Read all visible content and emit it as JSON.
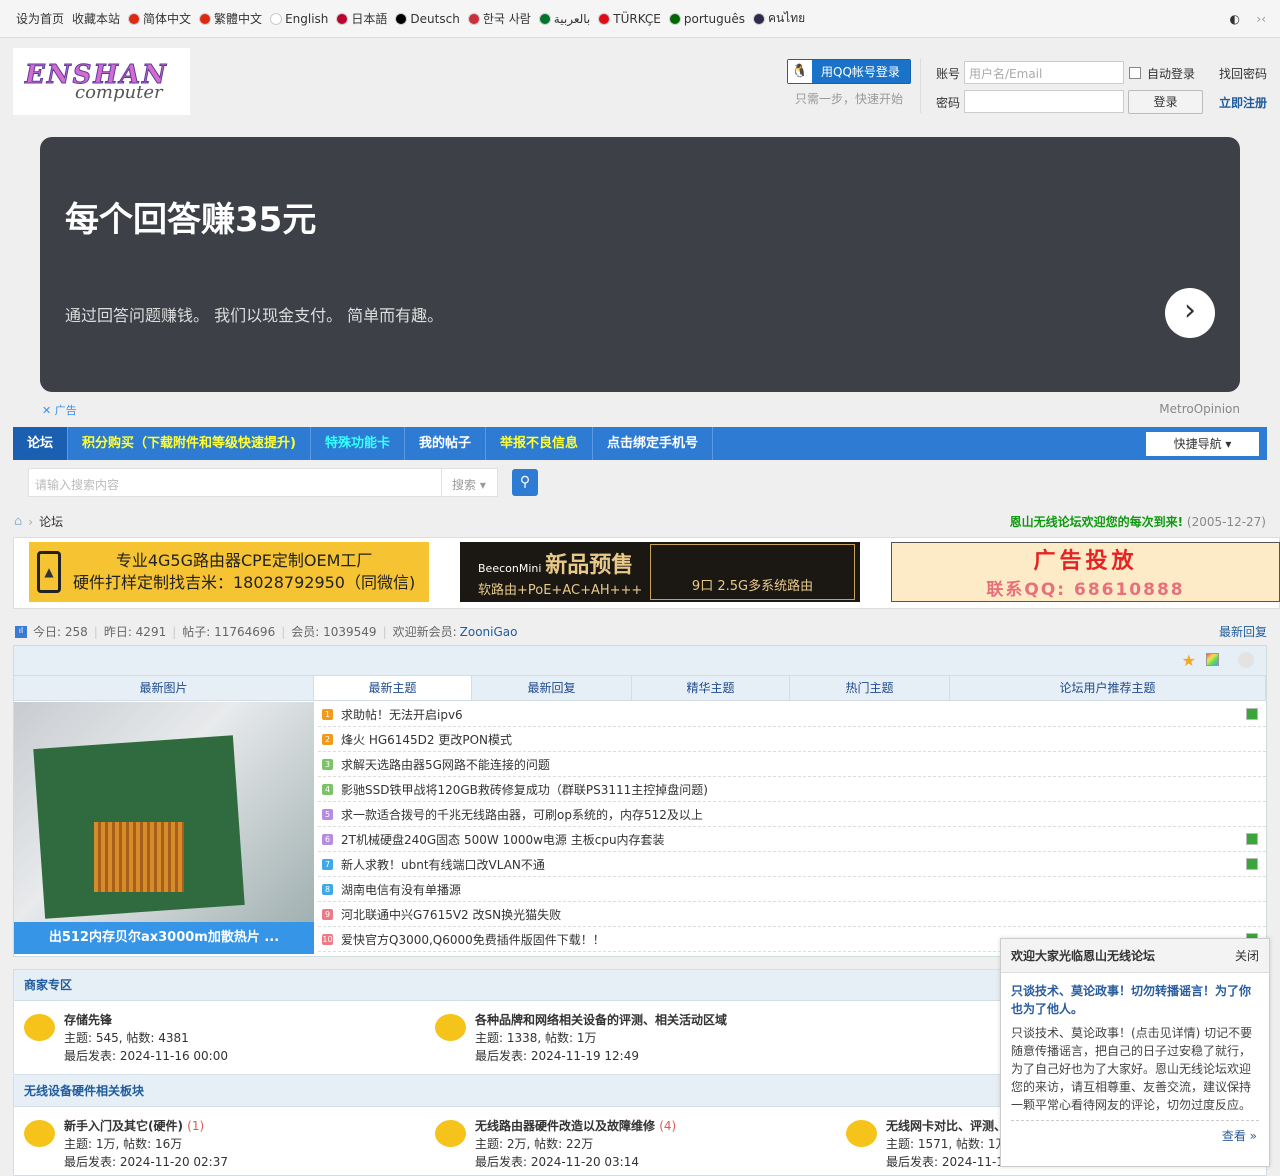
{
  "topbar": {
    "set_home": "设为首页",
    "favorite": "收藏本站",
    "langs": [
      {
        "label": "简体中文",
        "color": "#de2910"
      },
      {
        "label": "繁體中文",
        "color": "#de2910"
      },
      {
        "label": "English",
        "color": "#ffffff"
      },
      {
        "label": "日本語",
        "color": "#bc002d"
      },
      {
        "label": "Deutsch",
        "color": "#000000"
      },
      {
        "label": "한국 사람",
        "color": "#cd2e3a"
      },
      {
        "label": "بالعربية",
        "color": "#00732f"
      },
      {
        "label": "TÜRKÇE",
        "color": "#e30a17"
      },
      {
        "label": "português",
        "color": "#006600"
      },
      {
        "label": "คนไทย",
        "color": "#2d2a4a"
      }
    ]
  },
  "logo": {
    "line1": "ENSHAN",
    "line2": "computer"
  },
  "login": {
    "qq_button": "用QQ帐号登录",
    "qq_sub": "只需一步，快速开始",
    "account_label": "账号",
    "account_placeholder": "用户名/Email",
    "password_label": "密码",
    "auto_login": "自动登录",
    "find_password": "找回密码",
    "login_button": "登录",
    "register": "立即注册"
  },
  "banner": {
    "headline": "每个回答赚35元",
    "sub": "通过回答问题赚钱。 我们以现金支付。 简单而有趣。",
    "ad_tag": "广告",
    "brand": "MetroOpinion"
  },
  "nav": {
    "items": [
      {
        "label": "论坛",
        "color": "#ffffff"
      },
      {
        "label": "积分购买（下载附件和等级快速提升)",
        "color": "#ffff33"
      },
      {
        "label": "特殊功能卡",
        "color": "#33ffff"
      },
      {
        "label": "我的帖子",
        "color": "#ffffff"
      },
      {
        "label": "举报不良信息",
        "color": "#ffff33"
      },
      {
        "label": "点击绑定手机号",
        "color": "#ffffff"
      }
    ],
    "quick_nav": "快捷导航"
  },
  "search": {
    "placeholder": "请输入搜索内容",
    "type": "搜索"
  },
  "breadcrumb": {
    "current": "论坛"
  },
  "welcome": {
    "text": "恩山无线论坛欢迎您的每次到来!",
    "date": "(2005-12-27)"
  },
  "ads": [
    {
      "line1": "专业4G5G路由器CPE定制OEM工厂",
      "line2": "硬件打样定制找吉米：18028792950（同微信)"
    },
    {
      "brand": "BeeconMini",
      "title": "新品预售",
      "sub1": "软路由+PoE+AC+AH+++",
      "sub2": "9口 2.5G多系统路由"
    },
    {
      "title": "广告投放",
      "contact": "联系QQ: 68610888"
    }
  ],
  "stats": {
    "today": "今日: 258",
    "yesterday": "昨日: 4291",
    "posts": "帖子: 11764696",
    "members": "会员: 1039549",
    "new_member_label": "欢迎新会员:",
    "new_member": "ZooniGao",
    "latest_reply": "最新回复"
  },
  "tabs": [
    "最新图片",
    "最新主题",
    "最新回复",
    "精华主题",
    "热门主题",
    "论坛用户推荐主题"
  ],
  "picture_caption": "出512内存贝尔ax3000m加散热片 ...",
  "threads": [
    {
      "n": "1",
      "title": "求助帖！无法开启ipv6",
      "color": "#f29a1c",
      "dl": true
    },
    {
      "n": "2",
      "title": "烽火 HG6145D2 更改PON模式",
      "color": "#f29a1c",
      "dl": false
    },
    {
      "n": "3",
      "title": "求解天选路由器5G网路不能连接的问题",
      "color": "#7bc366",
      "dl": false
    },
    {
      "n": "4",
      "title": "影驰SSD铁甲战将120GB救砖修复成功（群联PS3111主控掉盘问题)",
      "color": "#7bc366",
      "dl": false
    },
    {
      "n": "5",
      "title": "求一款适合拨号的千兆无线路由器，可刷op系统的，内存512及以上",
      "color": "#b68be0",
      "dl": false
    },
    {
      "n": "6",
      "title": "2T机械硬盘240G固态 500W 1000w电源 主板cpu内存套装",
      "color": "#b68be0",
      "dl": true
    },
    {
      "n": "7",
      "title": "新人求教！ubnt有线端口改VLAN不通",
      "color": "#3fa9e8",
      "dl": true
    },
    {
      "n": "8",
      "title": "湖南电信有没有单播源",
      "color": "#3fa9e8",
      "dl": false
    },
    {
      "n": "9",
      "title": "河北联通中兴G7615V2 改SN换光猫失败",
      "color": "#ee7a86",
      "dl": false
    },
    {
      "n": "10",
      "title": "爱快官方Q3000,Q6000免费插件版固件下载！！",
      "color": "#ee7a86",
      "dl": true
    }
  ],
  "sections": [
    {
      "title": "商家专区",
      "forums": [
        {
          "name": "存储先锋",
          "new": "",
          "stats": "主题: 545, 帖数: 4381",
          "last": "最后发表: 2024-11-16 00:00"
        },
        {
          "name": "各种品牌和网络相关设备的评测、相关活动区域",
          "new": "",
          "stats": "主题: 1338, 帖数: 1万",
          "last": "最后发表: 2024-11-19 12:49"
        }
      ]
    },
    {
      "title": "无线设备硬件相关板块",
      "forums": [
        {
          "name": "新手入门及其它(硬件)",
          "new": "(1)",
          "stats": "主题: 1万, 帖数: 16万",
          "last": "最后发表: 2024-11-20 02:37"
        },
        {
          "name": "无线路由器硬件改造以及故障维修",
          "new": "(4)",
          "stats": "主题: 2万, 帖数: 22万",
          "last": "最后发表: 2024-11-20 03:14"
        },
        {
          "name": "无线网卡对比、评测、",
          "new": "",
          "stats": "主题: 1571, 帖数: 1万",
          "last": "最后发表: 2024-11-1"
        }
      ]
    }
  ],
  "popup": {
    "title": "欢迎大家光临恩山无线论坛",
    "close": "关闭",
    "headline": "只谈技术、莫论政事！切勿转播谣言！为了你也为了他人。",
    "body": "只谈技术、莫论政事！(点击见详情) 切记不要随意传播谣言，把自己的日子过安稳了就行，为了自己好也为了大家好。恩山无线论坛欢迎您的来访，请互相尊重、友善交流，建议保持一颗平常心看待网友的评论，切勿过度反应。",
    "more": "查看 »"
  }
}
